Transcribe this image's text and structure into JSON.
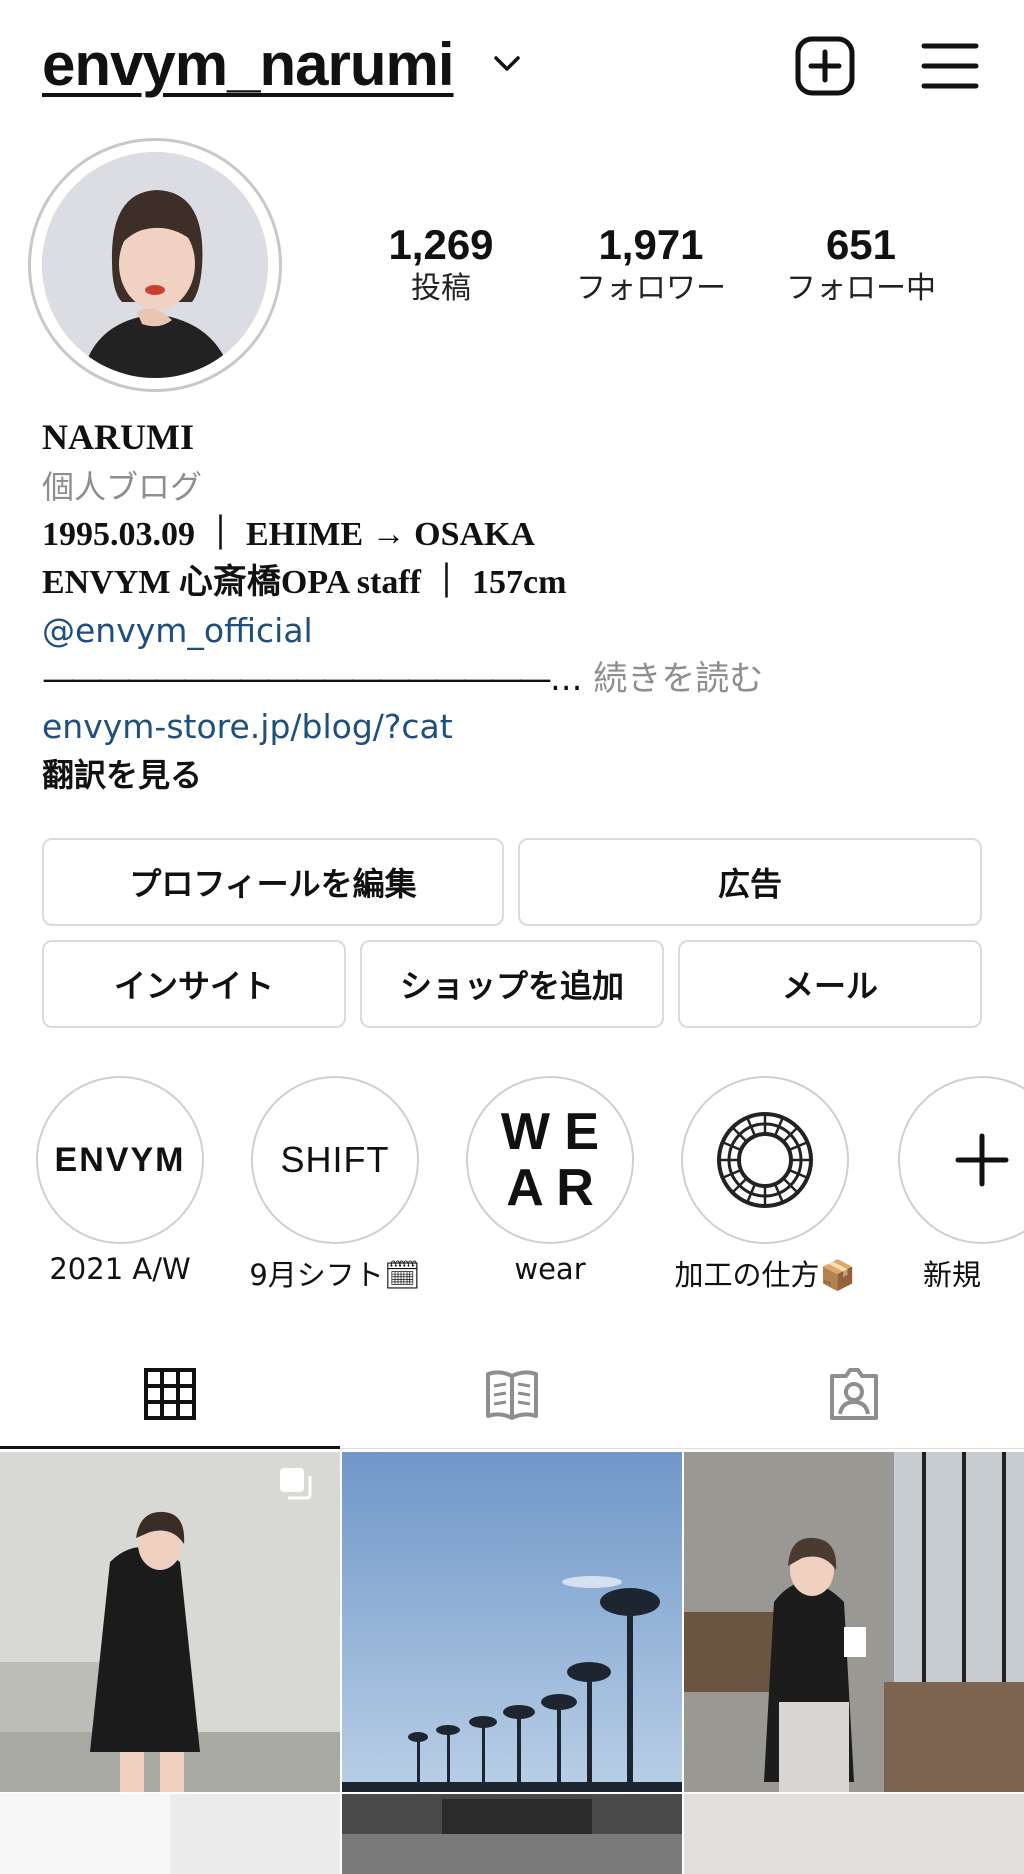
{
  "header": {
    "username": "envym_narumi",
    "icons": [
      "chevron-down-icon",
      "new-post-icon",
      "menu-icon"
    ]
  },
  "stats": [
    {
      "value": "1,269",
      "label": "投稿"
    },
    {
      "value": "1,971",
      "label": "フォロワー"
    },
    {
      "value": "651",
      "label": "フォロー中"
    }
  ],
  "bio": {
    "name": "NARUMI",
    "category": "個人ブログ",
    "line1": "1995.03.09 ｜ EHIME → OSAKA",
    "line2": "ENVYM 心斎橋OPA staff ｜ 157cm",
    "mention": "@envym_official",
    "divider": "——————————————————",
    "ellipsis": "...",
    "more": "続きを読む",
    "website": "envym-store.jp/blog/?cat",
    "translate": "翻訳を見る"
  },
  "buttons": {
    "edit_profile": "プロフィールを編集",
    "ads": "広告",
    "insights": "インサイト",
    "add_shop": "ショップを追加",
    "email": "メール"
  },
  "highlights": [
    {
      "cover": "ENVYM",
      "label": "2021 A/W"
    },
    {
      "cover": "SHIFT",
      "label": "9月シフト",
      "emoji": "🗓"
    },
    {
      "cover_lines": [
        "W E",
        "A R"
      ],
      "label": "wear"
    },
    {
      "cover": "ring-pattern-icon",
      "label": "加工の仕方",
      "emoji": "📦"
    },
    {
      "cover": "plus-icon",
      "label": "新規"
    }
  ],
  "tabs": [
    "grid-icon",
    "guide-icon",
    "tagged-icon"
  ]
}
